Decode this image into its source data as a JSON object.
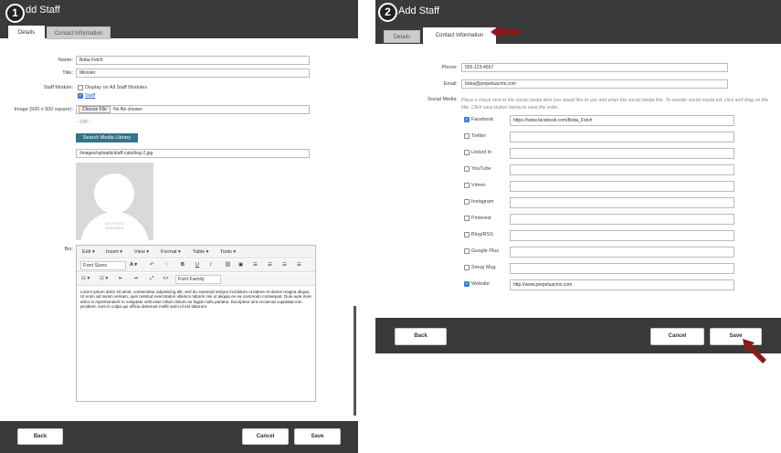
{
  "panel1": {
    "step": "1",
    "title": "dd Staff",
    "tabs": [
      "Details",
      "Contact Information"
    ],
    "labels": {
      "name": "Name:",
      "title": "Title:",
      "module": "Staff Module:",
      "image": "Image (500 x 500 square):",
      "bio": "Bio:"
    },
    "values": {
      "name": "Boba Fetch",
      "title": "Minister",
      "image_path": "/images/uploads/staff-cats/dog-2.jpg"
    },
    "module_options": [
      {
        "label": "Display on All Staff Modules",
        "checked": false
      },
      {
        "label": "Staff",
        "checked": true
      }
    ],
    "choose_file": "Choose File",
    "no_file": "No file chosen",
    "or": "- OR -",
    "search_media": "Search Media Library",
    "no_photo": "NO PHOTO\nAVAILABLE",
    "editor": {
      "menus": [
        "Edit ▾",
        "Insert ▾",
        "View ▾",
        "Format ▾",
        "Table ▾",
        "Tools ▾"
      ],
      "font_sizes": "Font Sizes",
      "font_family": "Font Family",
      "content": "Lorem ipsum dolor sit amet, consectetur adipisicing elit, sed do eiusmod tempor incididunt ut labore et dolore magna aliqua. Ut enim ad minim veniam, quis nostrud exercitation ullamco laboris nisi ut aliquip ex ea commodo consequat. Duis aute irure dolor in reprehenderit in voluptate velit esse cillum dolore eu fugiat nulla pariatur. Excepteur sint occaecat cupidatat non proident, sunt in culpa qui officia deserunt mollit anim id est laborum."
    },
    "footer": {
      "back": "Back",
      "cancel": "Cancel",
      "save": "Save"
    }
  },
  "panel2": {
    "step": "2",
    "title": "Add Staff",
    "tabs": [
      "Details",
      "Contact Information"
    ],
    "labels": {
      "phone": "Phone:",
      "email": "Email:",
      "social": "Social Media:"
    },
    "values": {
      "phone": "555-123-4567",
      "email": "boba@perpetuacms.com"
    },
    "social_instructions": "Place a check next to the social media item you would like to use and enter the social media link. To reorder social media list, click and drag on the title. Click save button below to save the order.",
    "social": [
      {
        "name": "Facebook",
        "checked": true,
        "url": "https://www.facebook.com/Boba_Fetch"
      },
      {
        "name": "Twitter",
        "checked": false,
        "url": ""
      },
      {
        "name": "Linked In",
        "checked": false,
        "url": ""
      },
      {
        "name": "YouTube",
        "checked": false,
        "url": ""
      },
      {
        "name": "Vimeo",
        "checked": false,
        "url": ""
      },
      {
        "name": "Instagram",
        "checked": false,
        "url": ""
      },
      {
        "name": "Pinterest",
        "checked": false,
        "url": ""
      },
      {
        "name": "Blog/RSS",
        "checked": false,
        "url": ""
      },
      {
        "name": "Google Plus",
        "checked": false,
        "url": ""
      },
      {
        "name": "Smug Mug",
        "checked": false,
        "url": ""
      },
      {
        "name": "Website",
        "checked": true,
        "url": "http://www.perpetuacms.com"
      }
    ],
    "footer": {
      "back": "Back",
      "cancel": "Cancel",
      "save": "Save"
    }
  },
  "colors": {
    "dark": "#3a3a3a",
    "accent": "#347489",
    "arrow": "#8b1a1a",
    "check": "#3b7ddd"
  }
}
